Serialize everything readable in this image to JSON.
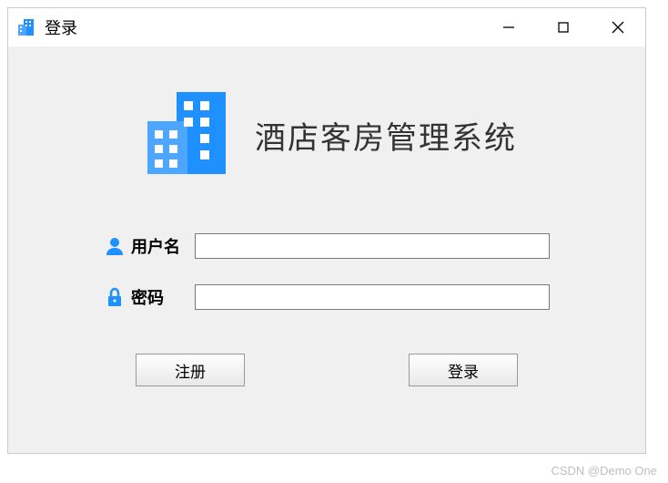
{
  "window": {
    "title": "登录"
  },
  "app": {
    "title": "酒店客房管理系统"
  },
  "form": {
    "username": {
      "label": "用户名",
      "value": ""
    },
    "password": {
      "label": "密码",
      "value": ""
    }
  },
  "buttons": {
    "register": "注册",
    "login": "登录"
  },
  "watermark": "CSDN @Demo One"
}
